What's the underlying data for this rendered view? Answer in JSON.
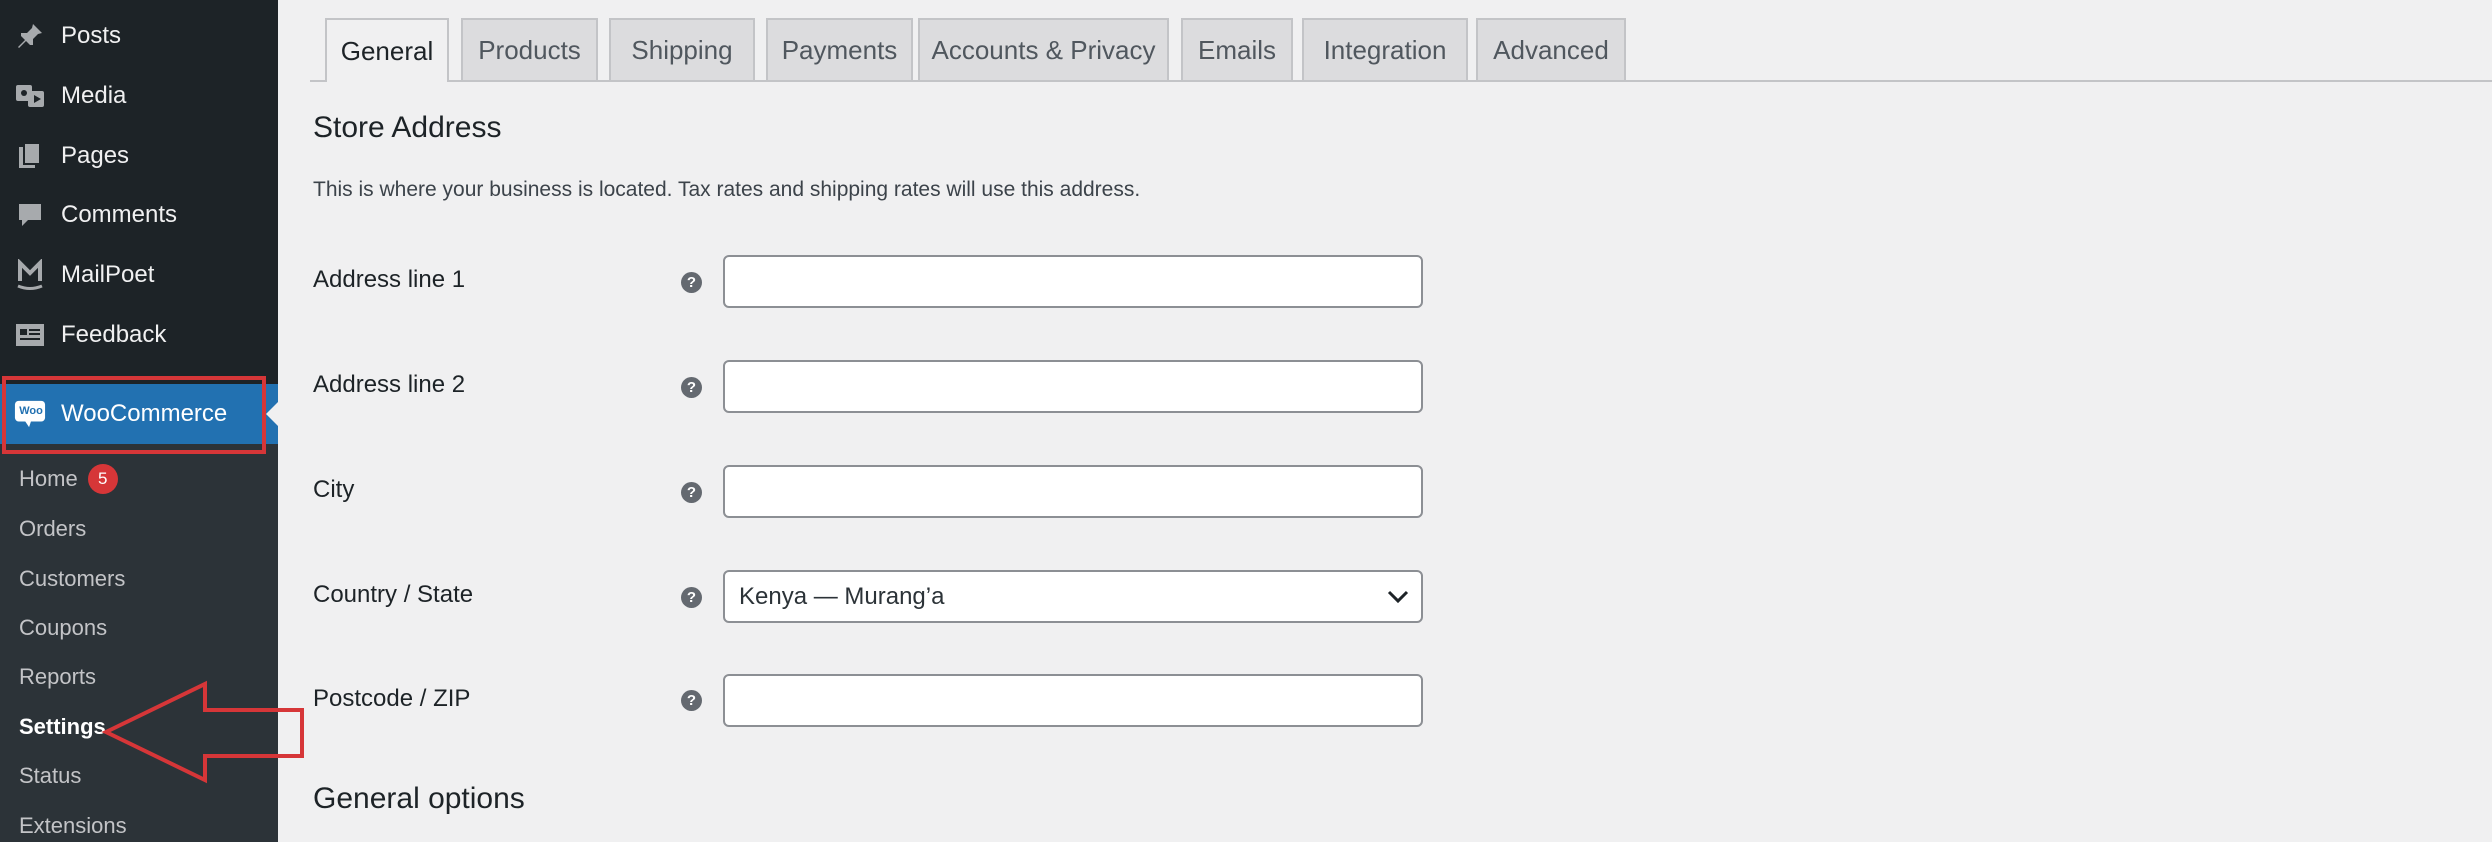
{
  "sidebar": {
    "menu": [
      {
        "label": "Posts",
        "icon": "pin-icon"
      },
      {
        "label": "Media",
        "icon": "media-icon"
      },
      {
        "label": "Pages",
        "icon": "pages-icon"
      },
      {
        "label": "Comments",
        "icon": "comment-icon"
      },
      {
        "label": "MailPoet",
        "icon": "mailpoet-icon"
      },
      {
        "label": "Feedback",
        "icon": "feedback-icon"
      }
    ],
    "woocommerce": {
      "label": "WooCommerce",
      "logo_text": "Woo"
    },
    "submenu": [
      {
        "label": "Home",
        "badge": "5"
      },
      {
        "label": "Orders"
      },
      {
        "label": "Customers"
      },
      {
        "label": "Coupons"
      },
      {
        "label": "Reports"
      },
      {
        "label": "Settings"
      },
      {
        "label": "Status"
      },
      {
        "label": "Extensions"
      }
    ]
  },
  "tabs": [
    "General",
    "Products",
    "Shipping",
    "Payments",
    "Accounts & Privacy",
    "Emails",
    "Integration",
    "Advanced"
  ],
  "active_tab": "General",
  "store_address": {
    "title": "Store Address",
    "description": "This is where your business is located. Tax rates and shipping rates will use this address.",
    "fields": [
      {
        "label": "Address line 1",
        "value": ""
      },
      {
        "label": "Address line 2",
        "value": ""
      },
      {
        "label": "City",
        "value": ""
      },
      {
        "label": "Country / State",
        "value": "Kenya — Murang’a"
      },
      {
        "label": "Postcode / ZIP",
        "value": ""
      }
    ],
    "help_glyph": "?"
  },
  "general_options": {
    "title": "General options"
  },
  "colors": {
    "sidebar_bg": "#1d2327",
    "accent": "#2271b1",
    "annotation": "#d63638"
  }
}
